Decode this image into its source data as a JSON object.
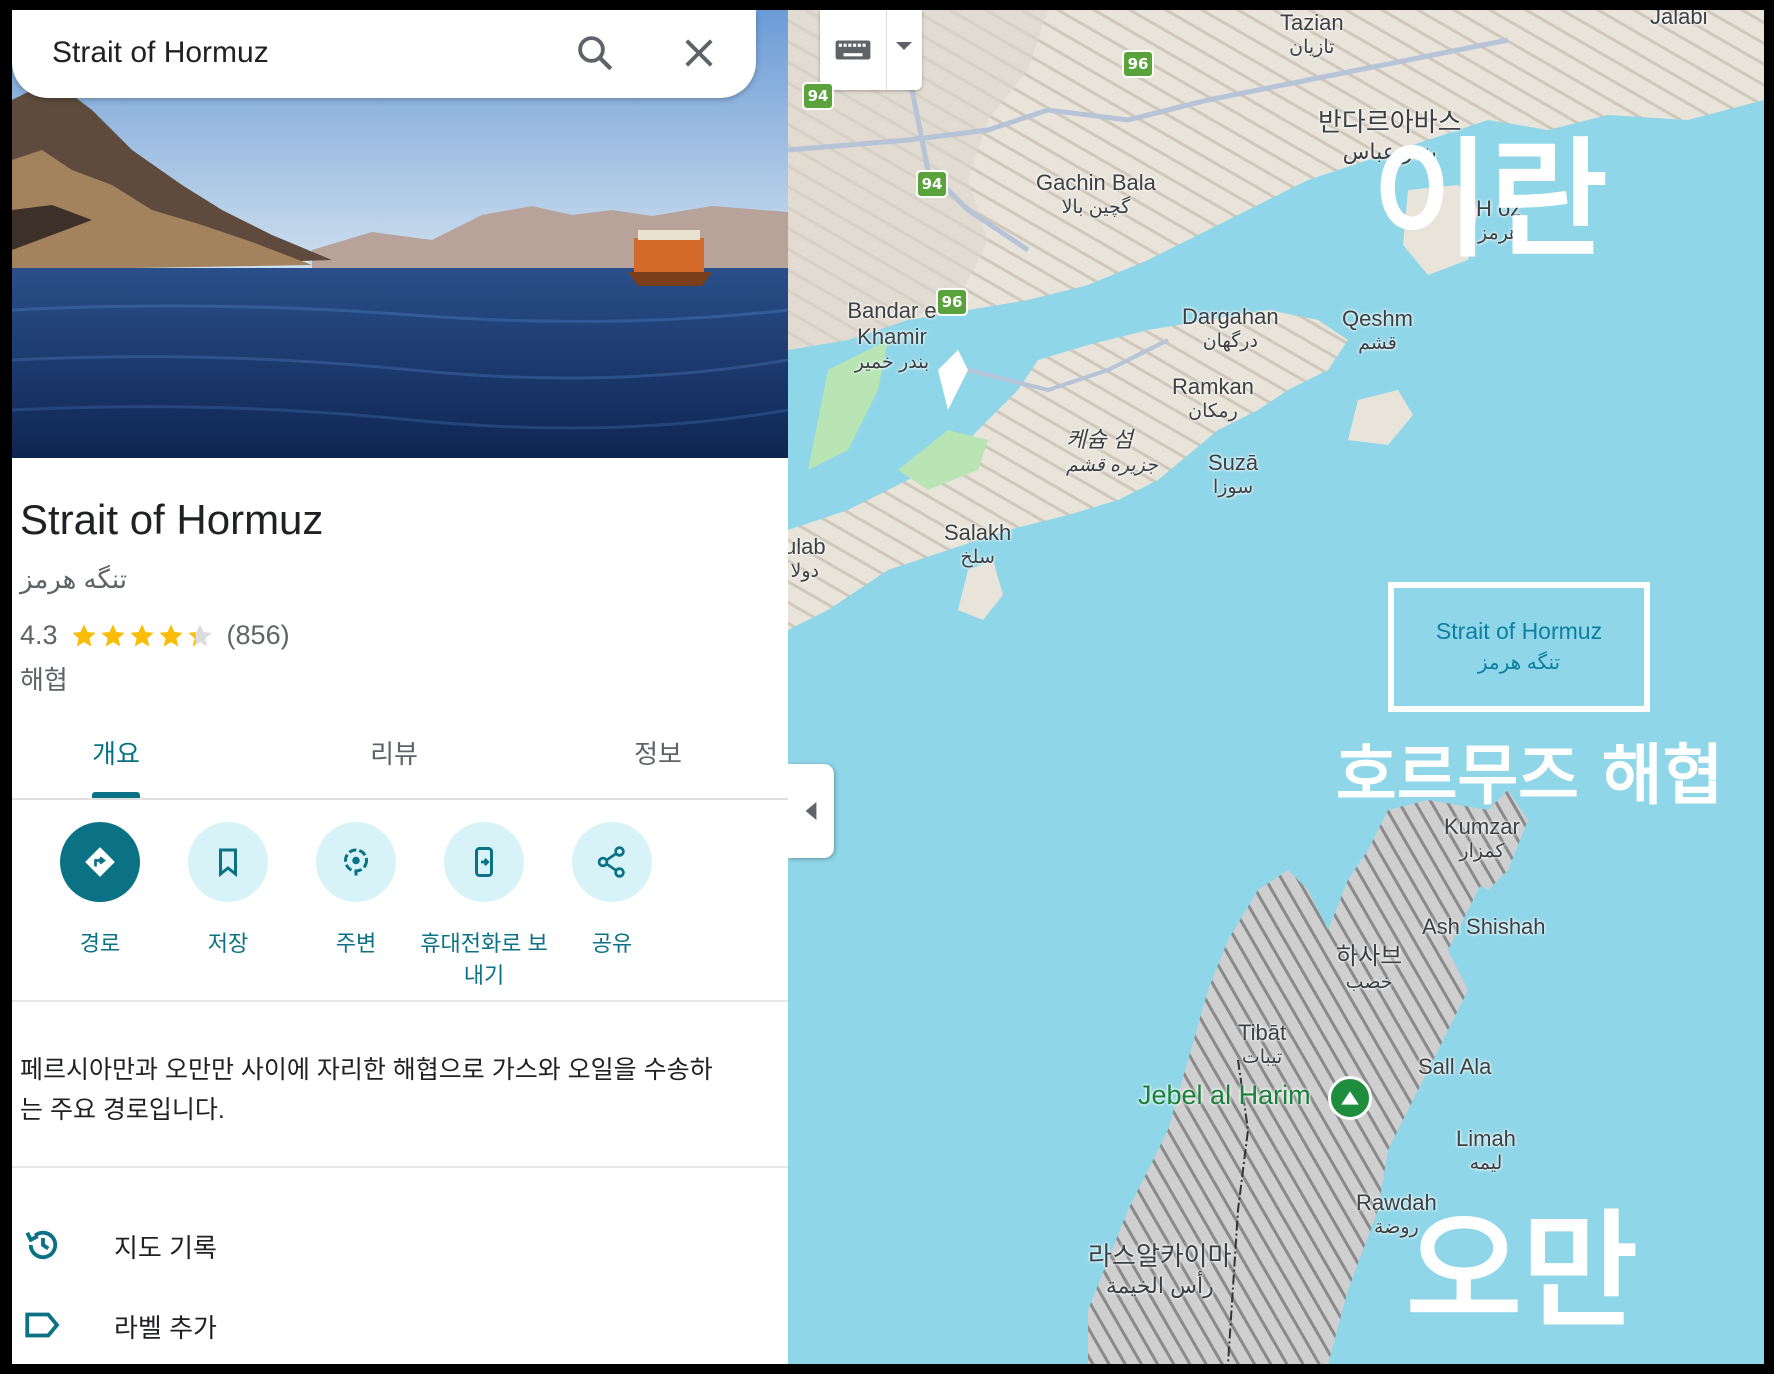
{
  "search": {
    "query": "Strait of Hormuz",
    "search_icon": "search-icon",
    "close_icon": "close-icon"
  },
  "place": {
    "name": "Strait of Hormuz",
    "local_name": "تنگه هرمز",
    "rating": "4.3",
    "rating_value": 4.3,
    "reviews": "(856)",
    "category": "해협",
    "star_color": "#fbbc04"
  },
  "tabs": [
    {
      "label": "개요",
      "active": true
    },
    {
      "label": "리뷰",
      "active": false
    },
    {
      "label": "정보",
      "active": false
    }
  ],
  "actions": [
    {
      "label": "경로",
      "icon": "directions-icon"
    },
    {
      "label": "저장",
      "icon": "bookmark-icon"
    },
    {
      "label": "주변",
      "icon": "nearby-icon"
    },
    {
      "label": "휴대전화로 보내기",
      "icon": "send-to-phone-icon"
    },
    {
      "label": "공유",
      "icon": "share-icon"
    }
  ],
  "description": "페르시아만과 오만만 사이에 자리한 해협으로 가스와 오일을 수송하는 주요 경로입니다.",
  "rows": [
    {
      "label": "지도 기록",
      "icon": "history-icon"
    },
    {
      "label": "라벨 추가",
      "icon": "label-icon"
    }
  ],
  "accent_color": "#0b7285",
  "map": {
    "highways": [
      "96",
      "94",
      "94",
      "96"
    ],
    "labels": {
      "tazian": {
        "name": "Tazian",
        "ar": "تازیان"
      },
      "jalabi": {
        "name": "Jalabi"
      },
      "bandar_abbas": {
        "name": "반다르아바스",
        "ar": "بندر عباس"
      },
      "gachin": {
        "name": "Gachin Bala",
        "ar": "گچین بالا"
      },
      "hormoz": {
        "name": "H   oz",
        "ar": "هرمز"
      },
      "khamir": {
        "name": "Bandar e Khamir",
        "ar": "بندر خمیر"
      },
      "dargahan": {
        "name": "Dargahan",
        "ar": "درگهان"
      },
      "qeshm": {
        "name": "Qeshm",
        "ar": "قشم"
      },
      "ramkan": {
        "name": "Ramkan",
        "ar": "رمکان"
      },
      "qeshm_island": {
        "name": "케슘 섬",
        "ar": "جزیره قشم"
      },
      "suza": {
        "name": "Suzā",
        "ar": "سوزا"
      },
      "salakh": {
        "name": "Salakh",
        "ar": "سلخ"
      },
      "dulab": {
        "name": "ulab",
        "ar": "دولا"
      },
      "kumzar": {
        "name": "Kumzar",
        "ar": "كمزار"
      },
      "ash_shishah": {
        "name": "Ash Shishah"
      },
      "khasab": {
        "name": "하사브",
        "ar": "خصب"
      },
      "tibat": {
        "name": "Tibāt",
        "ar": "تيبات"
      },
      "sall_ala": {
        "name": "Sall Ala"
      },
      "limah": {
        "name": "Limah",
        "ar": "ليمه"
      },
      "rawdah": {
        "name": "Rawdah",
        "ar": "روضة"
      },
      "rak": {
        "name": "라스알카이마",
        "ar": "رأس الخيمة"
      }
    },
    "strait_box": {
      "name": "Strait of Hormuz",
      "ar": "تنگه هرمز"
    },
    "jebel": "Jebel al Harim",
    "overlay_iran": "이란",
    "overlay_strait": "호르무즈 해협",
    "overlay_oman": "오만"
  }
}
